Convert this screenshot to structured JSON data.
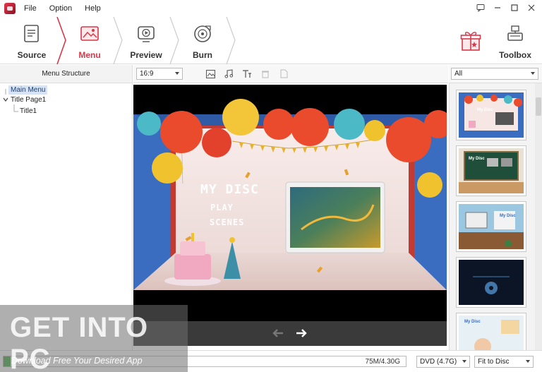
{
  "menubar": {
    "items": [
      "File",
      "Option",
      "Help"
    ]
  },
  "workflow": {
    "steps": [
      {
        "label": "Source",
        "icon": "document-icon"
      },
      {
        "label": "Menu",
        "icon": "image-icon"
      },
      {
        "label": "Preview",
        "icon": "play-icon"
      },
      {
        "label": "Burn",
        "icon": "disc-icon"
      }
    ],
    "active_step": "Menu",
    "toolbox_label": "Toolbox"
  },
  "menu_structure": {
    "title": "Menu Structure",
    "tree": [
      {
        "label": "Main Menu",
        "selected": true
      },
      {
        "label": "Title Page1"
      },
      {
        "label": "Title1"
      }
    ]
  },
  "center_toolbar": {
    "aspect_ratio": "16:9"
  },
  "preview": {
    "menu_title": "MY DISC",
    "menu_items": [
      "PLAY",
      "SCENES"
    ]
  },
  "templates": {
    "filter": "All",
    "thumb_titles": [
      "My Disc",
      "My Disc",
      "My Disc",
      "",
      "My Disc"
    ]
  },
  "status": {
    "capacity": "75M/4.30G",
    "disc_type": "DVD (4.7G)",
    "fit_mode": "Fit to Disc",
    "usage_fraction": 0.017
  },
  "watermark": {
    "brand": "GET INTO PC",
    "tagline": "Download Free Your Desired App"
  },
  "colors": {
    "accent": "#d7384a",
    "selection": "#d6e4f7"
  }
}
